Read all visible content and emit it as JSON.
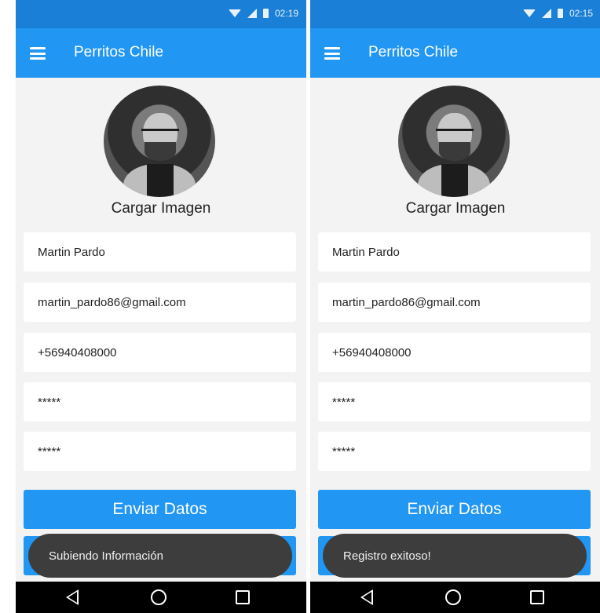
{
  "screens": [
    {
      "status_time": "02:19",
      "app_title": "Perritos Chile",
      "upload_label": "Cargar Imagen",
      "fields": {
        "name": "Martin Pardo",
        "email": "martin_pardo86@gmail.com",
        "phone": "+56940408000",
        "password": "*****",
        "confirm_password": "*****"
      },
      "send_button": "Enviar Datos",
      "toast": "Subiendo Información"
    },
    {
      "status_time": "02:15",
      "app_title": "Perritos Chile",
      "upload_label": "Cargar Imagen",
      "fields": {
        "name": "Martin Pardo",
        "email": "martin_pardo86@gmail.com",
        "phone": "+56940408000",
        "password": "*****",
        "confirm_password": "*****"
      },
      "send_button": "Enviar Datos",
      "toast": "Registro exitoso!"
    }
  ],
  "colors": {
    "status_bar": "#1a7fd6",
    "app_bar": "#2196f3",
    "button": "#2196f3",
    "toast": "#3d3d3d",
    "background": "#f3f3f3"
  },
  "icons": [
    "wifi-icon",
    "signal-icon",
    "battery-icon",
    "menu-icon",
    "back-icon",
    "home-icon",
    "recent-apps-icon"
  ]
}
